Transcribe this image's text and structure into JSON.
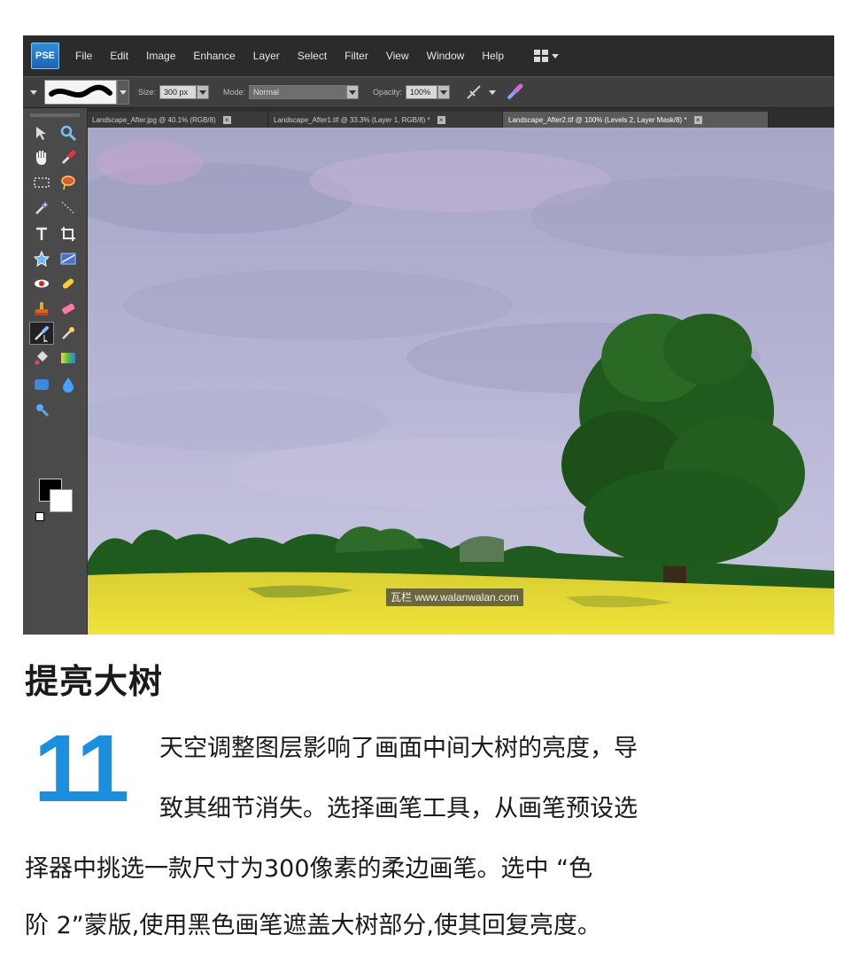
{
  "app": {
    "logo": "PSE",
    "menu": [
      "File",
      "Edit",
      "Image",
      "Enhance",
      "Layer",
      "Select",
      "Filter",
      "View",
      "Window",
      "Help"
    ]
  },
  "options_bar": {
    "size_label": "Size:",
    "size_value": "300 px",
    "mode_label": "Mode:",
    "mode_value": "Normal",
    "opacity_label": "Opacity:",
    "opacity_value": "100%"
  },
  "document_tabs": [
    {
      "label": "Landscape_After.jpg @ 40.1% (RGB/8)",
      "active": false
    },
    {
      "label": "Landscape_After1.tif @ 33.3% (Layer 1, RGB/8) *",
      "active": false
    },
    {
      "label": "Landscape_After2.tif @ 100% (Levels 2, Layer Mask/8) *",
      "active": true
    }
  ],
  "tab_close_glyph": "×",
  "tools": [
    "move-tool",
    "zoom-tool",
    "hand-tool",
    "eyedropper-tool",
    "marquee-tool",
    "lasso-tool",
    "magic-wand-tool",
    "selection-brush-tool",
    "type-tool",
    "crop-tool",
    "cookie-cutter-tool",
    "straighten-tool",
    "red-eye-tool",
    "spot-healing-tool",
    "clone-stamp-tool",
    "eraser-tool",
    "brush-tool",
    "smart-brush-tool",
    "paint-bucket-tool",
    "gradient-tool",
    "shape-tool",
    "blur-tool",
    "sponge-tool"
  ],
  "watermark": "瓦栏 www.walanwalan.com",
  "article": {
    "headline": "提亮大树",
    "step_number": "11",
    "lines": [
      "天空调整图层影响了画面中间大树的亮度，导",
      "致其细节消失。选择画笔工具，从画笔预设选",
      "择器中挑选一款尺寸为300像素的柔边画笔。选中 “色",
      "阶 2”蒙版,使用黑色画笔遮盖大树部分,使其回复亮度。"
    ]
  },
  "colors": {
    "accent_blue": "#1a8fde",
    "foreground_swatch": "#000000",
    "background_swatch": "#ffffff"
  }
}
